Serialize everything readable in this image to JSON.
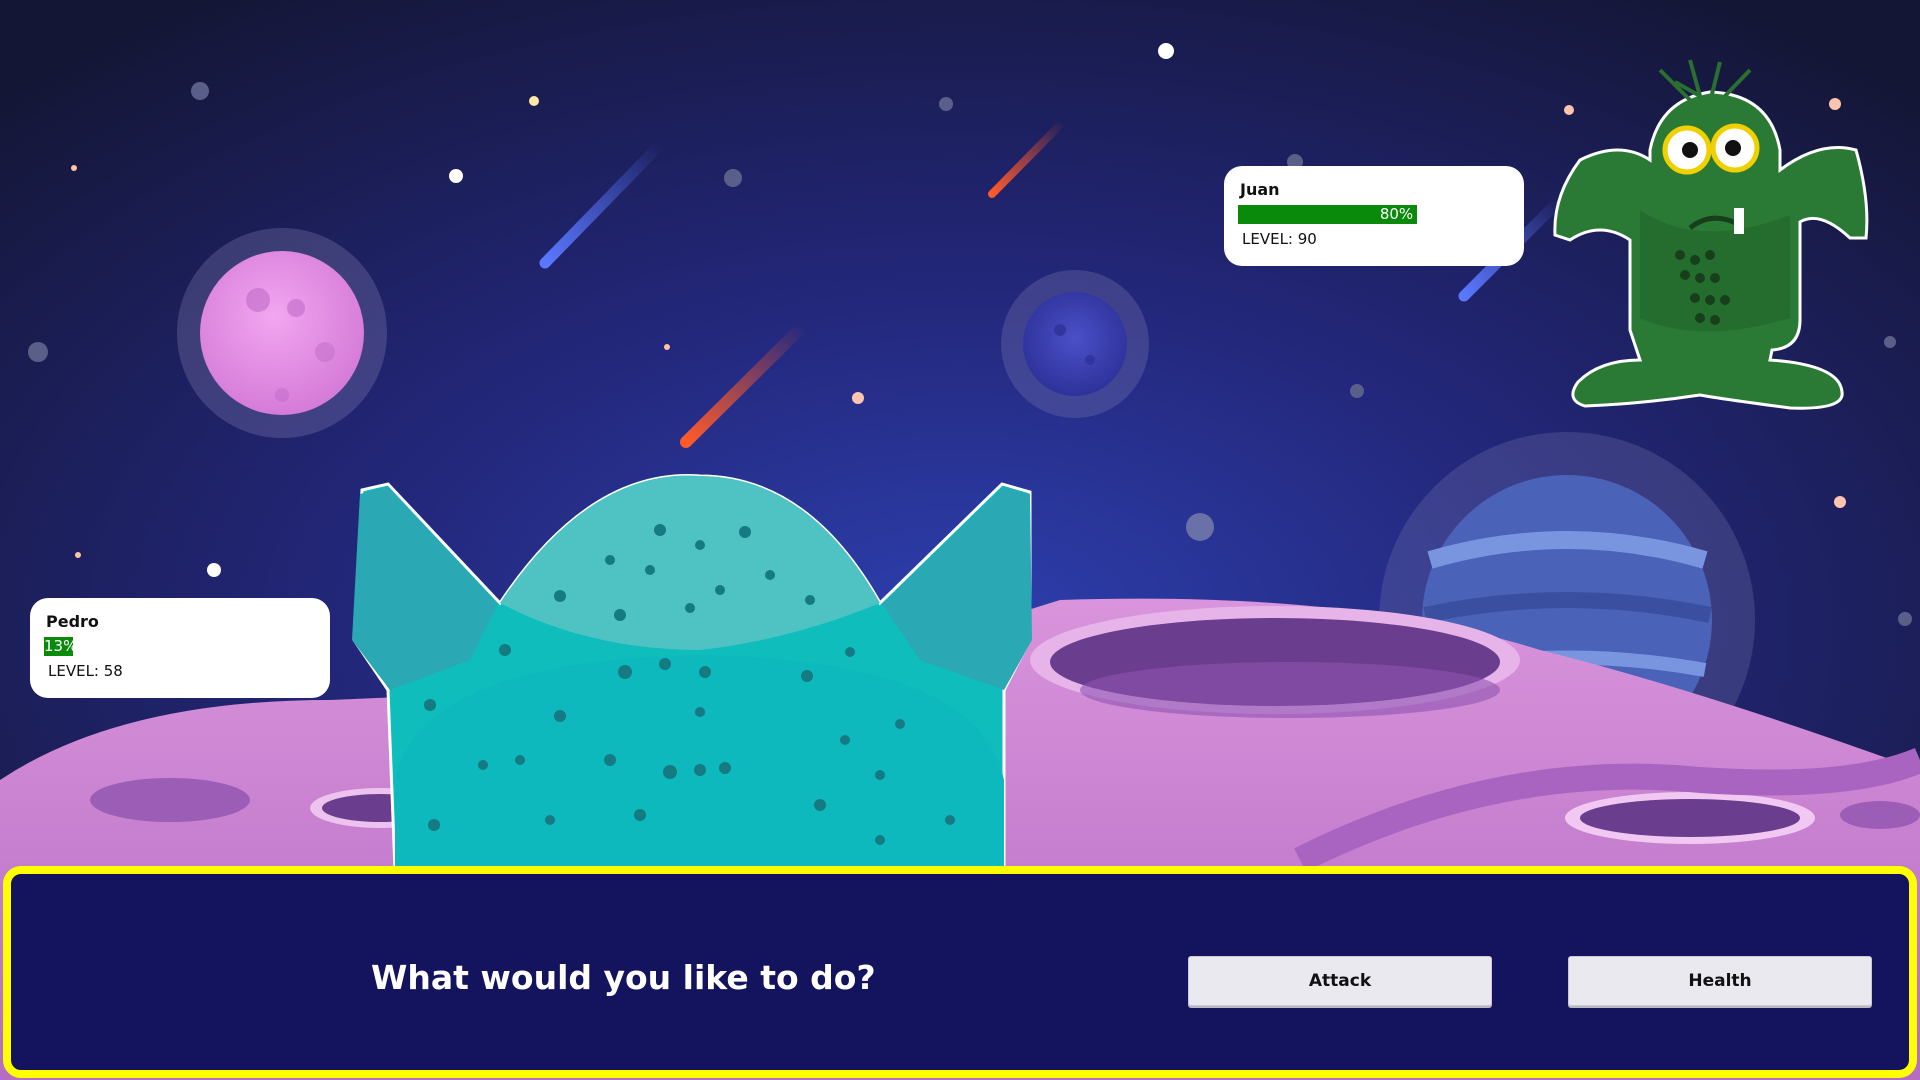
{
  "enemy": {
    "name": "Juan",
    "hp_percent": 80,
    "hp_label": "80%",
    "level_text": "LEVEL: 90"
  },
  "player": {
    "name": "Pedro",
    "hp_percent": 13,
    "hp_label": "13%",
    "level_text": "LEVEL: 58"
  },
  "dialog": {
    "prompt": "What would you like to do?",
    "attack_label": "Attack",
    "health_label": "Health"
  },
  "colors": {
    "sky": "#16163a",
    "hp_bar": "#0a8a0a",
    "dialog_bg": "#13135e",
    "dialog_border": "#ffff00",
    "player_monster": "#0fbdbd",
    "enemy_monster": "#2a7a35"
  }
}
